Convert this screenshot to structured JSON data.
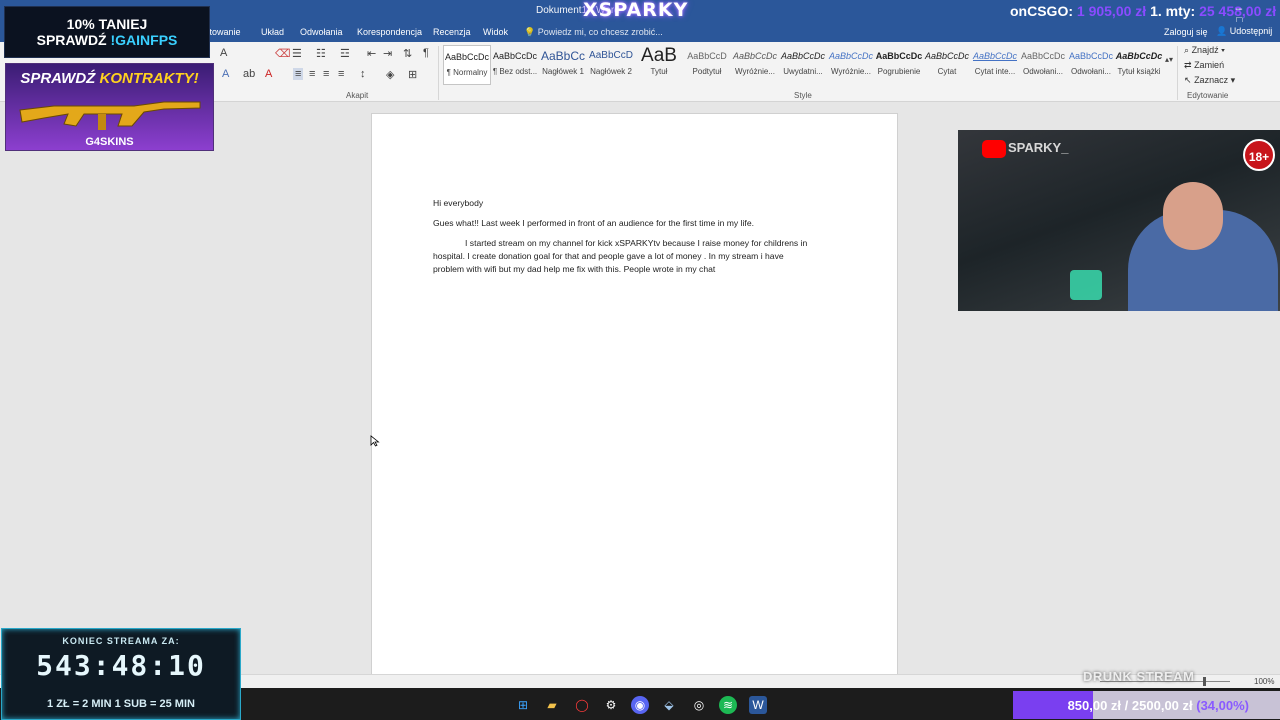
{
  "window": {
    "doc_title": "Dokument1 - Word",
    "overlay_name": "XSPARKY",
    "csgo_label": "onCSGO:",
    "csgo_money": "1 905,00 zł",
    "mty_label": "1. mty:",
    "mty_money": "25 458,00 zł",
    "window_controls": "–  □  ✕"
  },
  "ribbon_tabs": {
    "tabs": [
      "ktowanie",
      "Układ",
      "Odwołania",
      "Korespondencja",
      "Recenzja",
      "Widok"
    ],
    "tell_me": "Powiedz mi, co chcesz zrobić...",
    "signin": "Zaloguj się",
    "share": "Udostępnij"
  },
  "ribbon": {
    "group_paragraph": "Akapit",
    "group_styles": "Style",
    "group_editing": "Edytowanie",
    "styles": [
      {
        "sample": "AaBbCcDc",
        "name": "¶ Normalny"
      },
      {
        "sample": "AaBbCcDc",
        "name": "¶ Bez odst..."
      },
      {
        "sample": "AaBbCc",
        "name": "Nagłówek 1"
      },
      {
        "sample": "AaBbCcD",
        "name": "Nagłówek 2"
      },
      {
        "sample": "AaB",
        "name": "Tytuł"
      },
      {
        "sample": "AaBbCcD",
        "name": "Podtytuł"
      },
      {
        "sample": "AaBbCcDc",
        "name": "Wyróżnie..."
      },
      {
        "sample": "AaBbCcDc",
        "name": "Uwydatni..."
      },
      {
        "sample": "AaBbCcDc",
        "name": "Wyróżnie..."
      },
      {
        "sample": "AaBbCcDc",
        "name": "Pogrubienie"
      },
      {
        "sample": "AaBbCcDc",
        "name": "Cytat"
      },
      {
        "sample": "AaBbCcDc",
        "name": "Cytat inte..."
      },
      {
        "sample": "AaBbCcDc",
        "name": "Odwołani..."
      },
      {
        "sample": "AaBbCcDc",
        "name": "Odwołani..."
      },
      {
        "sample": "AaBbCcDc",
        "name": "Tytuł książki"
      }
    ],
    "edit_find": "Znajdź",
    "edit_replace": "Zamień",
    "edit_select": "Zaznacz"
  },
  "document": {
    "line1": "Hi everybody",
    "line2": "Gues what!! Last week I performed in front of an audience for the first time in my life.",
    "line3": "I started stream on my channel for kick xSPARKYtv because I raise money for childrens in",
    "line4": "hospital. I create donation goal for that and people gave a lot of money . In my stream i have",
    "line5": "problem with wifi but my dad help me fix with this. People wrote in my chat"
  },
  "status": {
    "zoom": "100%",
    "overlay_text": "DRUNK STREAM"
  },
  "overlays": {
    "promo_line1": "10% TANIEJ",
    "promo_line2_a": "SPRAWDŹ",
    "promo_line2_b": "!GAINFPS",
    "contracts_a": "SPRAWDŹ",
    "contracts_b": "KONTRAKTY!",
    "contracts_brand": "G4SKINS",
    "timer_label": "KONIEC STREAMA ZA:",
    "timer_value": "543:48:10",
    "timer_rule": "1 ZŁ = 2 MIN   1 SUB = 25 MIN",
    "channel": "SPARKY_",
    "age_badge": "18+",
    "donation_current": "850,00 zł",
    "donation_goal": "2500,00 zł",
    "donation_percent": "(34,00%)"
  },
  "colors": {
    "word_blue": "#2b579a",
    "accent_purple": "#7a3ff0",
    "timer_cyan": "#2aa8c9"
  }
}
